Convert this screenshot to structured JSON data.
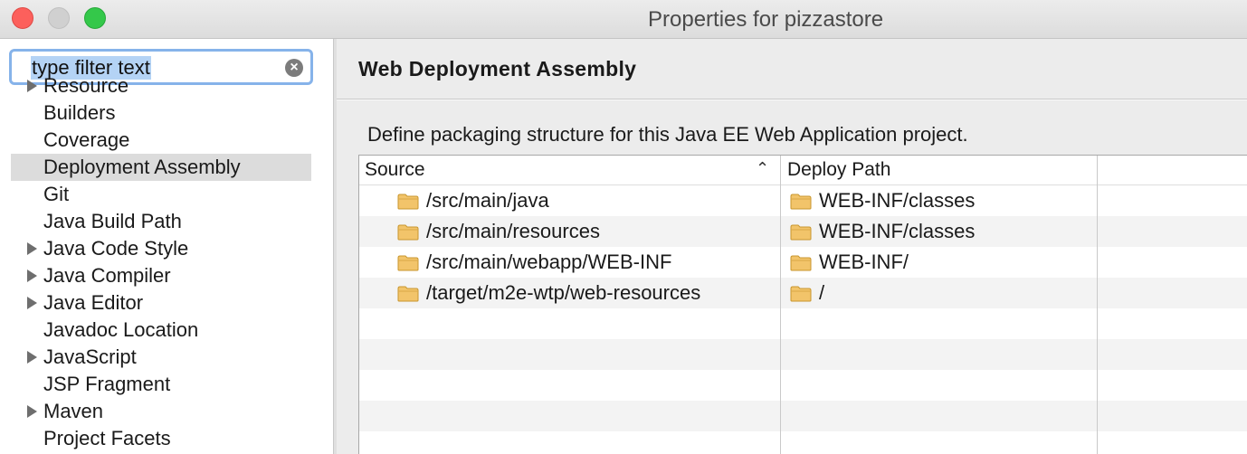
{
  "window": {
    "title": "Properties for pizzastore"
  },
  "filter": {
    "text": "type filter text"
  },
  "tree": [
    {
      "label": "Resource",
      "expandable": true
    },
    {
      "label": "Builders",
      "expandable": false
    },
    {
      "label": "Coverage",
      "expandable": false
    },
    {
      "label": "Deployment Assembly",
      "expandable": false,
      "selected": true
    },
    {
      "label": "Git",
      "expandable": false
    },
    {
      "label": "Java Build Path",
      "expandable": false
    },
    {
      "label": "Java Code Style",
      "expandable": true
    },
    {
      "label": "Java Compiler",
      "expandable": true
    },
    {
      "label": "Java Editor",
      "expandable": true
    },
    {
      "label": "Javadoc Location",
      "expandable": false
    },
    {
      "label": "JavaScript",
      "expandable": true
    },
    {
      "label": "JSP Fragment",
      "expandable": false
    },
    {
      "label": "Maven",
      "expandable": true
    },
    {
      "label": "Project Facets",
      "expandable": false
    }
  ],
  "page": {
    "title": "Web Deployment Assembly",
    "description": "Define packaging structure for this Java EE Web Application project."
  },
  "table": {
    "columns": [
      "Source",
      "Deploy Path"
    ],
    "rows": [
      {
        "source": "/src/main/java",
        "deploy": "WEB-INF/classes"
      },
      {
        "source": "/src/main/resources",
        "deploy": "WEB-INF/classes"
      },
      {
        "source": "/src/main/webapp/WEB-INF",
        "deploy": "WEB-INF/"
      },
      {
        "source": "/target/m2e-wtp/web-resources",
        "deploy": "/"
      }
    ]
  },
  "icons": {
    "folder": "folder-icon",
    "clear": "clear-search-icon",
    "sort": "sort-ascending-icon"
  },
  "colors": {
    "selection": "#dcdcdc",
    "focus_ring": "#86b3ea",
    "folder": "#f2c46a"
  }
}
